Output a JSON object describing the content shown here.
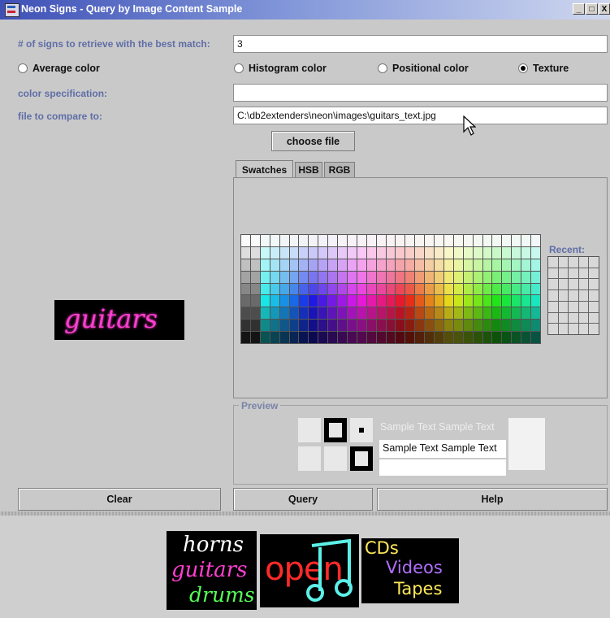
{
  "window": {
    "title": "Neon Signs - Query by Image Content Sample",
    "buttons": [
      "_",
      "□",
      "X"
    ]
  },
  "form": {
    "num_signs_label": "# of signs to retrieve with the best match:",
    "num_signs_value": "3",
    "radios": [
      {
        "label": "Average color",
        "selected": false
      },
      {
        "label": "Histogram color",
        "selected": false
      },
      {
        "label": "Positional color",
        "selected": false
      },
      {
        "label": "Texture",
        "selected": true
      }
    ],
    "color_spec_label": "color specification:",
    "color_spec_value": "",
    "file_label": "file to compare to:",
    "file_value": "C:\\db2extenders\\neon\\images\\guitars_text.jpg",
    "choose_file_label": "choose file"
  },
  "query_image": {
    "text": "guitars"
  },
  "color_chooser": {
    "tabs": [
      "Swatches",
      "HSB",
      "RGB"
    ],
    "active_tab": "Swatches",
    "recent_label": "Recent:",
    "preview_label": "Preview",
    "sample_text": "Sample Text  Sample Text"
  },
  "buttons": {
    "clear": "Clear",
    "query": "Query",
    "help": "Help"
  },
  "results": {
    "sign1": [
      "horns",
      "guitars",
      "drums"
    ],
    "sign2": "open",
    "sign3": [
      "CDs",
      "Videos",
      "Tapes"
    ]
  },
  "colors": {
    "label_blue": "#5f6ea7",
    "neon_pink": "#ff3fd0",
    "neon_red": "#ff2a2a",
    "neon_cyan": "#5cf0e8",
    "neon_green": "#58ff58",
    "neon_yellow": "#ffe95a",
    "neon_purple": "#b070ff"
  }
}
